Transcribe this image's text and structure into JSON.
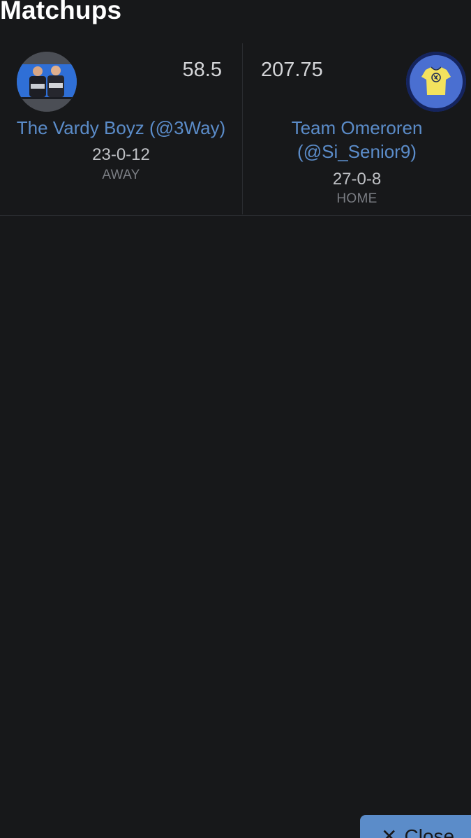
{
  "header": {
    "title": "Matchups"
  },
  "matchup": {
    "away": {
      "avatar_icon": "wrestlers-photo-avatar",
      "score": "58.5",
      "name": "The Vardy Boyz (@3Way)",
      "record": "23-0-12",
      "side": "AWAY"
    },
    "home": {
      "avatar_icon": "yellow-jersey-avatar",
      "score": "207.75",
      "name": "Team Omeroren (@Si_Senior9)",
      "record": "27-0-8",
      "side": "HOME"
    }
  },
  "footer": {
    "close_label": "Close",
    "close_icon": "close-icon"
  },
  "colors": {
    "background": "#17181a",
    "accent": "#5b8cc9",
    "text_primary": "#ffffff",
    "text_secondary": "#bfc1c5",
    "text_muted": "#7a7d83"
  }
}
